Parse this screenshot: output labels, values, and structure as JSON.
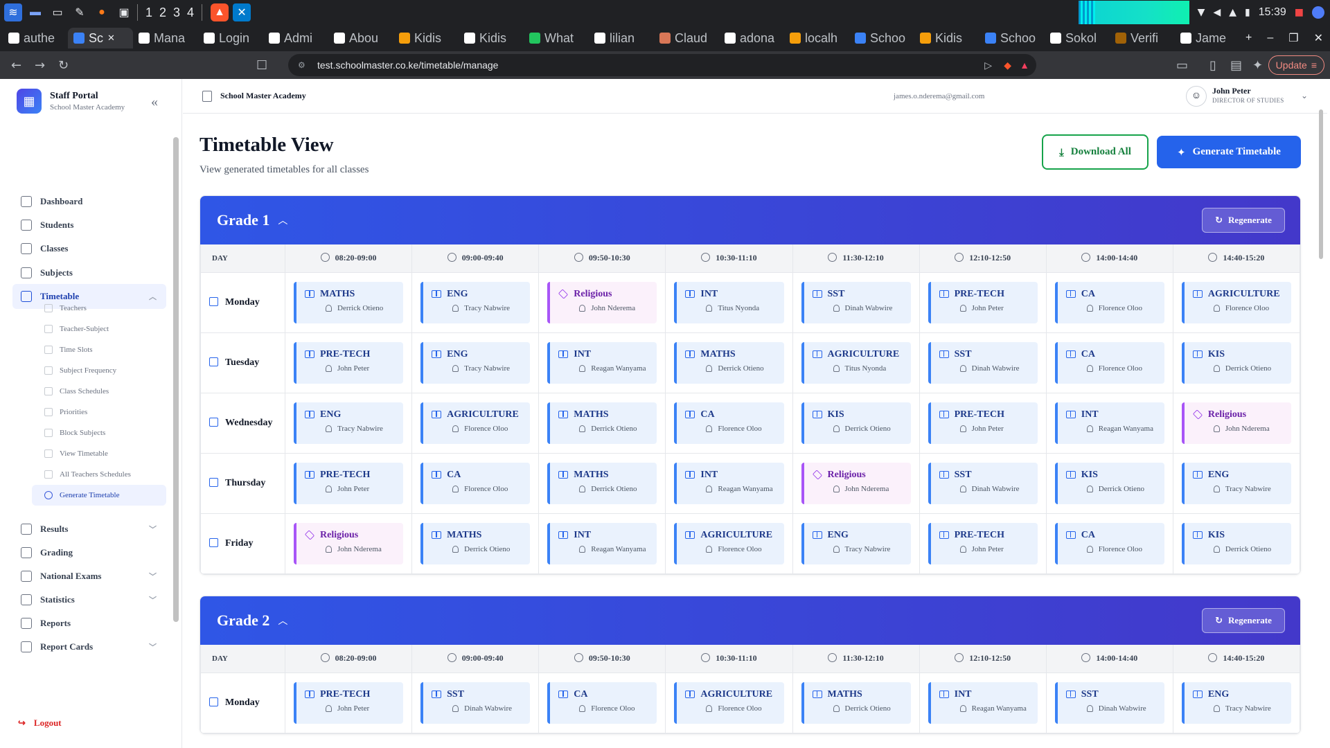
{
  "os": {
    "workspaces": [
      "1",
      "2",
      "3",
      "4"
    ],
    "time": "15:39"
  },
  "browser": {
    "tabs": [
      {
        "label": "authe",
        "color": "#ffffff"
      },
      {
        "label": "Sc",
        "color": "#3b82f6",
        "active": true
      },
      {
        "label": "Mana",
        "color": "#ffffff"
      },
      {
        "label": "Login",
        "color": "#ffffff"
      },
      {
        "label": "Admi",
        "color": "#ffffff"
      },
      {
        "label": "Abou",
        "color": "#ffffff"
      },
      {
        "label": "Kidis",
        "color": "#f59e0b"
      },
      {
        "label": "Kidis",
        "color": "#ffffff"
      },
      {
        "label": "What",
        "color": "#22c55e"
      },
      {
        "label": "lilian",
        "color": "#ffffff"
      },
      {
        "label": "Claud",
        "color": "#d97757"
      },
      {
        "label": "adona",
        "color": "#ffffff"
      },
      {
        "label": "localh",
        "color": "#f59e0b"
      },
      {
        "label": "Schoo",
        "color": "#3b82f6"
      },
      {
        "label": "Kidis",
        "color": "#f59e0b"
      },
      {
        "label": "Schoo",
        "color": "#3b82f6"
      },
      {
        "label": "Sokol",
        "color": "#ffffff"
      },
      {
        "label": "Verifi",
        "color": "#a16207"
      },
      {
        "label": "Jame",
        "color": "#ffffff"
      }
    ],
    "url": "test.schoolmaster.co.ke/timetable/manage",
    "update_label": "Update"
  },
  "sidebar": {
    "title": "Staff Portal",
    "subtitle": "School Master Academy",
    "nav": [
      {
        "label": "Dashboard",
        "icon": "dashboard-icon"
      },
      {
        "label": "Students",
        "icon": "students-icon"
      },
      {
        "label": "Classes",
        "icon": "classes-icon"
      },
      {
        "label": "Subjects",
        "icon": "subjects-icon"
      },
      {
        "label": "Timetable",
        "icon": "calendar-icon",
        "active": true
      }
    ],
    "sub_nav": [
      "Teachers",
      "Teacher-Subject",
      "Time Slots",
      "Subject Frequency",
      "Class Schedules",
      "Priorities",
      "Block Subjects",
      "View Timetable",
      "All Teachers Schedules",
      "Generate Timetable"
    ],
    "nav_bottom": [
      {
        "label": "Results",
        "chevron": true
      },
      {
        "label": "Grading",
        "chevron": false
      },
      {
        "label": "National Exams",
        "chevron": true
      },
      {
        "label": "Statistics",
        "chevron": true
      },
      {
        "label": "Reports",
        "chevron": false
      },
      {
        "label": "Report Cards",
        "chevron": true
      }
    ],
    "logout_label": "Logout"
  },
  "topbar": {
    "school_name": "School Master Academy",
    "email": "james.o.nderema@gmail.com",
    "user_name": "John Peter",
    "user_role": "DIRECTOR OF STUDIES"
  },
  "page": {
    "title": "Timetable View",
    "subtitle": "View generated timetables for all classes",
    "download_label": "Download All",
    "generate_label": "Generate Timetable",
    "regenerate_label": "Regenerate",
    "day_header": "DAY",
    "time_slots": [
      "08:20-09:00",
      "09:00-09:40",
      "09:50-10:30",
      "10:30-11:10",
      "11:30-12:10",
      "12:10-12:50",
      "14:00-14:40",
      "14:40-15:20"
    ]
  },
  "grades": [
    {
      "name": "Grade 1",
      "rows": [
        {
          "day": "Monday",
          "cells": [
            [
              "MATHS",
              "Derrick Otieno"
            ],
            [
              "ENG",
              "Tracy Nabwire"
            ],
            [
              "Religious",
              "John Nderema"
            ],
            [
              "INT",
              "Titus Nyonda"
            ],
            [
              "SST",
              "Dinah Wabwire"
            ],
            [
              "PRE-TECH",
              "John Peter"
            ],
            [
              "CA",
              "Florence Oloo"
            ],
            [
              "AGRICULTURE",
              "Florence Oloo"
            ]
          ]
        },
        {
          "day": "Tuesday",
          "cells": [
            [
              "PRE-TECH",
              "John Peter"
            ],
            [
              "ENG",
              "Tracy Nabwire"
            ],
            [
              "INT",
              "Reagan Wanyama"
            ],
            [
              "MATHS",
              "Derrick Otieno"
            ],
            [
              "AGRICULTURE",
              "Titus Nyonda"
            ],
            [
              "SST",
              "Dinah Wabwire"
            ],
            [
              "CA",
              "Florence Oloo"
            ],
            [
              "KIS",
              "Derrick Otieno"
            ]
          ]
        },
        {
          "day": "Wednesday",
          "cells": [
            [
              "ENG",
              "Tracy Nabwire"
            ],
            [
              "AGRICULTURE",
              "Florence Oloo"
            ],
            [
              "MATHS",
              "Derrick Otieno"
            ],
            [
              "CA",
              "Florence Oloo"
            ],
            [
              "KIS",
              "Derrick Otieno"
            ],
            [
              "PRE-TECH",
              "John Peter"
            ],
            [
              "INT",
              "Reagan Wanyama"
            ],
            [
              "Religious",
              "John Nderema"
            ]
          ]
        },
        {
          "day": "Thursday",
          "cells": [
            [
              "PRE-TECH",
              "John Peter"
            ],
            [
              "CA",
              "Florence Oloo"
            ],
            [
              "MATHS",
              "Derrick Otieno"
            ],
            [
              "INT",
              "Reagan Wanyama"
            ],
            [
              "Religious",
              "John Nderema"
            ],
            [
              "SST",
              "Dinah Wabwire"
            ],
            [
              "KIS",
              "Derrick Otieno"
            ],
            [
              "ENG",
              "Tracy Nabwire"
            ]
          ]
        },
        {
          "day": "Friday",
          "cells": [
            [
              "Religious",
              "John Nderema"
            ],
            [
              "MATHS",
              "Derrick Otieno"
            ],
            [
              "INT",
              "Reagan Wanyama"
            ],
            [
              "AGRICULTURE",
              "Florence Oloo"
            ],
            [
              "ENG",
              "Tracy Nabwire"
            ],
            [
              "PRE-TECH",
              "John Peter"
            ],
            [
              "CA",
              "Florence Oloo"
            ],
            [
              "KIS",
              "Derrick Otieno"
            ]
          ]
        }
      ]
    },
    {
      "name": "Grade 2",
      "rows": [
        {
          "day": "Monday",
          "cells": [
            [
              "PRE-TECH",
              "John Peter"
            ],
            [
              "SST",
              "Dinah Wabwire"
            ],
            [
              "CA",
              "Florence Oloo"
            ],
            [
              "AGRICULTURE",
              "Florence Oloo"
            ],
            [
              "MATHS",
              "Derrick Otieno"
            ],
            [
              "INT",
              "Reagan Wanyama"
            ],
            [
              "SST",
              "Dinah Wabwire"
            ],
            [
              "ENG",
              "Tracy Nabwire"
            ]
          ]
        }
      ]
    }
  ],
  "colors": {
    "primary": "#2563eb",
    "success": "#16a34a",
    "religious": "#a855f7",
    "danger": "#dc2626"
  }
}
